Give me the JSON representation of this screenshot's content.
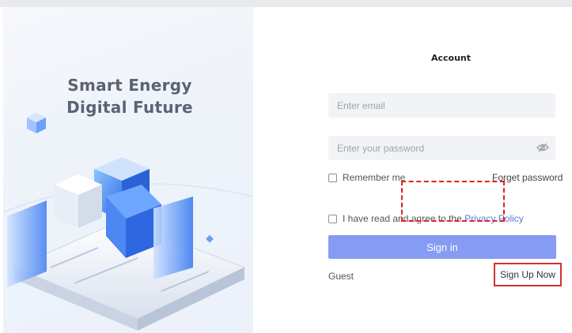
{
  "hero": {
    "title_line1": "Smart Energy",
    "title_line2": "Digital Future"
  },
  "form": {
    "heading": "Account",
    "email": {
      "placeholder": "Enter email",
      "value": ""
    },
    "password": {
      "placeholder": "Enter your password",
      "value": ""
    },
    "remember_label": "Remember me",
    "forget_label": "Forget password",
    "agree_prefix": "I have read and agree to the ",
    "privacy_label": "Privacy Policy",
    "signin_label": "Sign in",
    "guest_label": "Guest",
    "signup_label": "Sign Up Now"
  },
  "colors": {
    "primary_button": "#869bf3",
    "link": "#5b7bd9",
    "highlight_red": "#d32f2f"
  },
  "icons": {
    "password_toggle": "eye-slash-icon"
  }
}
